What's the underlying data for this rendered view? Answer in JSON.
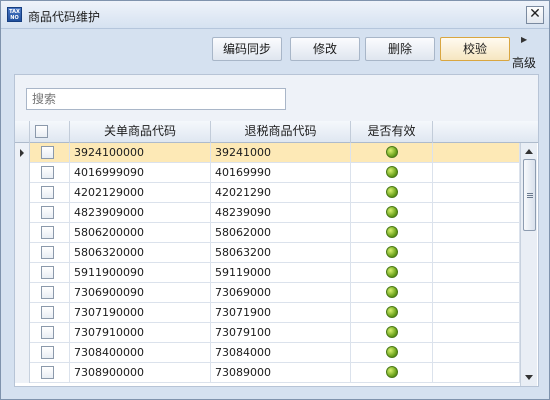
{
  "window": {
    "title": "商品代码维护",
    "icon_text": "TAX NO"
  },
  "toolbar": {
    "buttons": [
      "编码同步",
      "修改",
      "删除",
      "校验"
    ],
    "active_index": 3,
    "advanced_label": "高级"
  },
  "search": {
    "placeholder": "搜索",
    "value": ""
  },
  "grid": {
    "columns": [
      "关单商品代码",
      "退税商品代码",
      "是否有效"
    ],
    "selected_row": 0,
    "rows": [
      {
        "customs_code": "3924100000",
        "refund_code": "39241000",
        "valid": true
      },
      {
        "customs_code": "4016999090",
        "refund_code": "40169990",
        "valid": true
      },
      {
        "customs_code": "4202129000",
        "refund_code": "42021290",
        "valid": true
      },
      {
        "customs_code": "4823909000",
        "refund_code": "48239090",
        "valid": true
      },
      {
        "customs_code": "5806200000",
        "refund_code": "58062000",
        "valid": true
      },
      {
        "customs_code": "5806320000",
        "refund_code": "58063200",
        "valid": true
      },
      {
        "customs_code": "5911900090",
        "refund_code": "59119000",
        "valid": true
      },
      {
        "customs_code": "7306900090",
        "refund_code": "73069000",
        "valid": true
      },
      {
        "customs_code": "7307190000",
        "refund_code": "73071900",
        "valid": true
      },
      {
        "customs_code": "7307910000",
        "refund_code": "73079100",
        "valid": true
      },
      {
        "customs_code": "7308400000",
        "refund_code": "73084000",
        "valid": true
      },
      {
        "customs_code": "7308900000",
        "refund_code": "73089000",
        "valid": true
      }
    ]
  },
  "colors": {
    "selected_row": "#fde9b6",
    "valid_dot": "#6fa51f",
    "active_button_border": "#d9a640"
  }
}
